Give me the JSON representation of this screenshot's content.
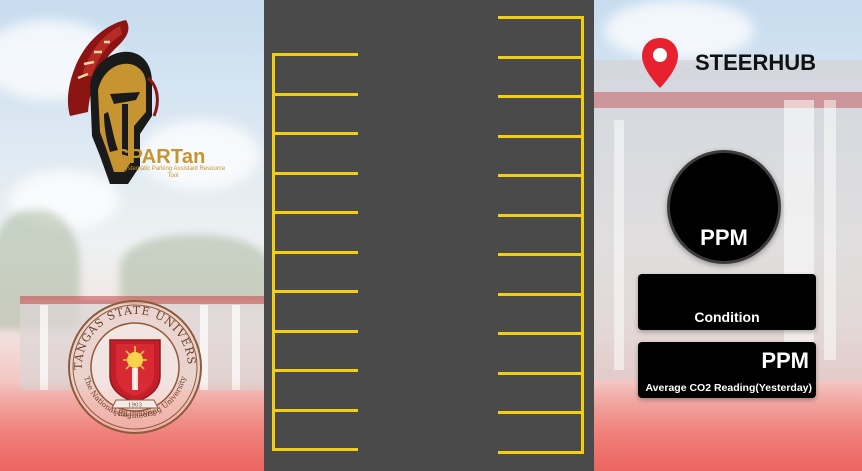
{
  "branding": {
    "app_name": "SPARTan",
    "tagline": "Systematic Parking Assistant Resource Tool",
    "university_seal_text": "BATANGAS STATE UNIVERSITY",
    "university_motto": "The National Engineering University",
    "seal_year": "1903",
    "seal_country": "PHILIPPINES"
  },
  "location": {
    "name": "STEERHUB",
    "icon": "map-pin-icon"
  },
  "co2_gauge": {
    "unit": "PPM"
  },
  "condition_card": {
    "label": "Condition"
  },
  "yesterday_card": {
    "unit": "PPM",
    "label": "Average CO2 Reading(Yesterday)"
  },
  "parking_lot": {
    "left_slots": 10,
    "right_slots": 11
  },
  "colors": {
    "lot_asphalt": "#4a4a4a",
    "lane_marking": "#f2cf12",
    "pin_red": "#e8212e",
    "brand_gold": "#c69430",
    "card_black": "#000000"
  }
}
